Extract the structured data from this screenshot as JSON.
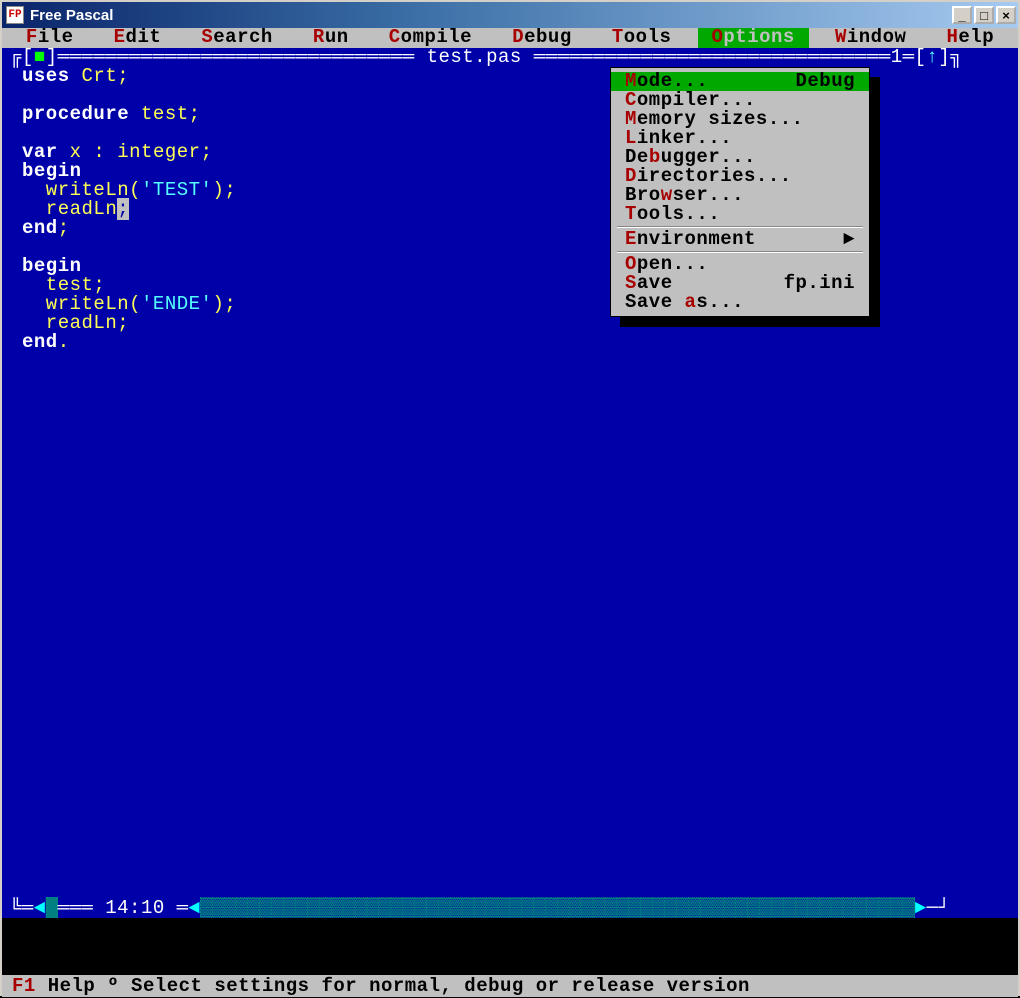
{
  "window": {
    "title": "Free Pascal",
    "icon_letters": "FP"
  },
  "winbuttons": {
    "min": "_",
    "max": "□",
    "close": "×"
  },
  "menubar": [
    {
      "hot": "F",
      "rest": "ile",
      "name": "file"
    },
    {
      "hot": "E",
      "rest": "dit",
      "name": "edit"
    },
    {
      "hot": "S",
      "rest": "earch",
      "name": "search"
    },
    {
      "hot": "R",
      "rest": "un",
      "name": "run"
    },
    {
      "hot": "C",
      "rest": "ompile",
      "name": "compile"
    },
    {
      "hot": "D",
      "rest": "ebug",
      "name": "debug"
    },
    {
      "hot": "T",
      "rest": "ools",
      "name": "tools"
    },
    {
      "hot": "O",
      "rest": "ptions",
      "name": "options",
      "selected": true
    },
    {
      "hot": "W",
      "rest": "indow",
      "name": "window"
    },
    {
      "hot": "H",
      "rest": "elp",
      "name": "help"
    }
  ],
  "editor": {
    "filename": "test.pas",
    "window_number": "1",
    "cursor_pos": "14:10"
  },
  "code_tokens": [
    [
      {
        "c": "kw",
        "t": "uses "
      },
      {
        "c": "id",
        "t": "Crt"
      },
      {
        "c": "sym",
        "t": ";"
      }
    ],
    [],
    [
      {
        "c": "kw",
        "t": "procedure "
      },
      {
        "c": "id",
        "t": "test"
      },
      {
        "c": "sym",
        "t": ";"
      }
    ],
    [],
    [
      {
        "c": "kw",
        "t": "var "
      },
      {
        "c": "id",
        "t": "x "
      },
      {
        "c": "sym",
        "t": ": "
      },
      {
        "c": "id",
        "t": "integer"
      },
      {
        "c": "sym",
        "t": ";"
      }
    ],
    [
      {
        "c": "kw",
        "t": "begin"
      }
    ],
    [
      {
        "c": "id",
        "t": "  writeLn"
      },
      {
        "c": "sym",
        "t": "("
      },
      {
        "c": "str",
        "t": "'TEST'"
      },
      {
        "c": "sym",
        "t": ");"
      }
    ],
    [
      {
        "c": "id",
        "t": "  readLn"
      },
      {
        "c": "cursor",
        "t": ";"
      }
    ],
    [
      {
        "c": "kw",
        "t": "end"
      },
      {
        "c": "sym",
        "t": ";"
      }
    ],
    [],
    [
      {
        "c": "kw",
        "t": "begin"
      }
    ],
    [
      {
        "c": "id",
        "t": "  test"
      },
      {
        "c": "sym",
        "t": ";"
      }
    ],
    [
      {
        "c": "id",
        "t": "  writeLn"
      },
      {
        "c": "sym",
        "t": "("
      },
      {
        "c": "str",
        "t": "'ENDE'"
      },
      {
        "c": "sym",
        "t": ");"
      }
    ],
    [
      {
        "c": "id",
        "t": "  readLn"
      },
      {
        "c": "sym",
        "t": ";"
      }
    ],
    [
      {
        "c": "kw",
        "t": "end"
      },
      {
        "c": "sym",
        "t": "."
      }
    ]
  ],
  "dropdown": {
    "groups": [
      [
        {
          "pre": "",
          "hot": "M",
          "post": "ode...",
          "rhs": "Debug",
          "selected": true,
          "name": "mode"
        },
        {
          "pre": "",
          "hot": "C",
          "post": "ompiler...",
          "rhs": "",
          "name": "compiler"
        },
        {
          "pre": "",
          "hot": "M",
          "post": "emory sizes...",
          "rhs": "",
          "name": "memory-sizes"
        },
        {
          "pre": "",
          "hot": "L",
          "post": "inker...",
          "rhs": "",
          "name": "linker"
        },
        {
          "pre": "De",
          "hot": "b",
          "post": "ugger...",
          "rhs": "",
          "name": "debugger"
        },
        {
          "pre": "",
          "hot": "D",
          "post": "irectories...",
          "rhs": "",
          "name": "directories"
        },
        {
          "pre": "Bro",
          "hot": "w",
          "post": "ser...",
          "rhs": "",
          "name": "browser"
        },
        {
          "pre": "",
          "hot": "T",
          "post": "ools...",
          "rhs": "",
          "name": "tools-opt"
        }
      ],
      [
        {
          "pre": "",
          "hot": "E",
          "post": "nvironment",
          "rhs": "",
          "submenu": true,
          "name": "environment"
        }
      ],
      [
        {
          "pre": "",
          "hot": "O",
          "post": "pen...",
          "rhs": "",
          "name": "open"
        },
        {
          "pre": "",
          "hot": "S",
          "post": "ave",
          "rhs": "fp.ini",
          "name": "save"
        },
        {
          "pre": "Save ",
          "hot": "a",
          "post": "s...",
          "rhs": "",
          "name": "save-as"
        }
      ]
    ]
  },
  "status": {
    "fkey": "F1",
    "text1": " Help ",
    "sep": "º",
    "text2": " Select settings for normal, debug or release version"
  }
}
